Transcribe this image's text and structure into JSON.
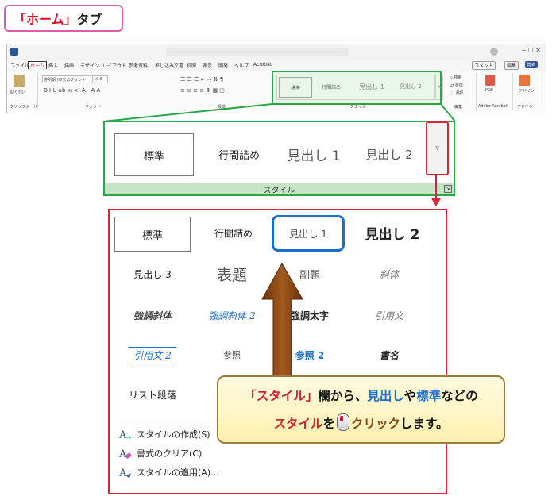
{
  "header": {
    "label_open": "「ホーム」",
    "label_suffix": "タブ"
  },
  "ribbon": {
    "tabs": [
      "ファイル",
      "ホーム",
      "挿入",
      "描画",
      "デザイン",
      "レイアウト",
      "参考資料",
      "差し込み文書",
      "校閲",
      "表示",
      "開発",
      "ヘルプ",
      "Acrobat"
    ],
    "active_tab": "ホーム",
    "comment": "コメント",
    "edit": "編集",
    "share": "共有",
    "font_name": "游明朝 (本文のフォント",
    "font_size": "10.5",
    "groups": [
      "クリップボード",
      "フォント",
      "段落",
      "スタイル",
      "編集",
      "Adobe Acrobat",
      "アドイン"
    ],
    "paste": "貼り付け",
    "mini_styles": [
      "標準",
      "行間詰め",
      "見出し 1",
      "見出し 2"
    ],
    "find": "検索",
    "replace": "置換",
    "select": "選択",
    "pdf": "PDF",
    "addin": "アドイン"
  },
  "gallery": {
    "styles": [
      "標準",
      "行間詰め",
      "見出し 1",
      "見出し 2"
    ],
    "group_label": "スタイル"
  },
  "dropdown": {
    "rows": [
      [
        "標準",
        "行間詰め",
        "見出し 1",
        "見出し 2"
      ],
      [
        "見出し 3",
        "表題",
        "副題",
        "斜体"
      ],
      [
        "強調斜体",
        "強調斜体 2",
        "強調太字",
        "引用文"
      ],
      [
        "引用文 2",
        "参照",
        "参照 2",
        "書名"
      ],
      [
        "リスト段落"
      ]
    ],
    "menu": [
      "スタイルの作成(S)",
      "書式のクリア(C)",
      "スタイルの適用(A)..."
    ]
  },
  "callout": {
    "l1_a": "「スタイル」",
    "l1_b": "欄から、",
    "l1_c": "見出し",
    "l1_d": "や",
    "l1_e": "標準",
    "l1_f": "などの",
    "l2_a": "スタイル",
    "l2_b": "を",
    "l2_c": "クリック",
    "l2_d": "します。"
  },
  "colors": {
    "accent_green": "#29a845",
    "accent_red": "#d6273a",
    "accent_blue": "#1c6fd0",
    "arrow_brown": "#8b4513"
  }
}
